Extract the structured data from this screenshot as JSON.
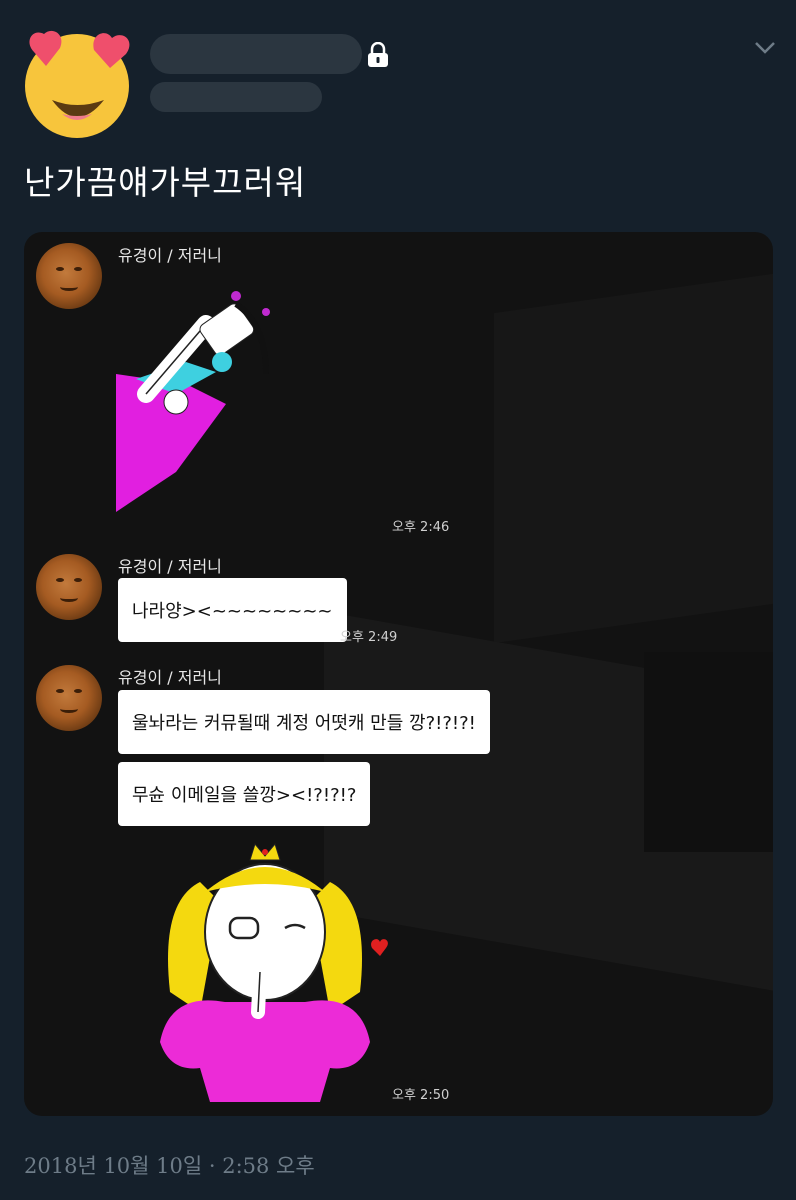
{
  "tweet": {
    "text": "난가끔얘가부끄러워",
    "timestamp": "2018년 10월 10일 · 2:58 오후",
    "locked": true
  },
  "icons": [
    "heart-eyes-emoji-icon",
    "lock-icon",
    "chevron-down-icon"
  ],
  "chat": {
    "messages": [
      {
        "sender": "유경이 / 저러니",
        "type": "sticker",
        "time": "오후 2:46"
      },
      {
        "sender": "유경이 / 저러니",
        "type": "text",
        "bubbles": [
          "나라양><~~~~~~~~"
        ],
        "time": "오후 2:49"
      },
      {
        "sender": "유경이 / 저러니",
        "type": "text+sticker",
        "bubbles": [
          "울놔라는 커뮤될때 계정 어떳캐 만들  깡?!?!?!",
          "무슌 이메일을 쓸깡><!?!?!?"
        ],
        "time": "오후 2:50"
      }
    ]
  },
  "colors": {
    "background": "#15202b",
    "chat_bg": "#121212",
    "bubble": "#ffffff",
    "muted_text": "#6e7c88"
  }
}
